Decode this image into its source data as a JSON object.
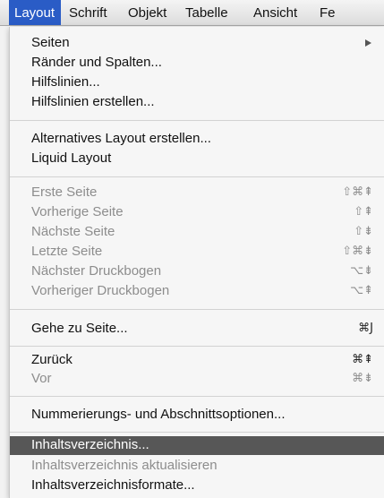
{
  "menubar": {
    "items": [
      "Layout",
      "Schrift",
      "Objekt",
      "Tabelle",
      "Ansicht",
      "Fe"
    ]
  },
  "menu": {
    "seiten": "Seiten",
    "raender": "Ränder und Spalten...",
    "hilfslinien": "Hilfslinien...",
    "hilfslinien_erstellen": "Hilfslinien erstellen...",
    "alt_layout": "Alternatives Layout erstellen...",
    "liquid": "Liquid Layout",
    "erste": {
      "label": "Erste Seite",
      "shortcut": "⇧⌘⇞"
    },
    "vorherige": {
      "label": "Vorherige Seite",
      "shortcut": "⇧⇞"
    },
    "naechste": {
      "label": "Nächste Seite",
      "shortcut": "⇧⇟"
    },
    "letzte": {
      "label": "Letzte Seite",
      "shortcut": "⇧⌘⇟"
    },
    "naechster_db": {
      "label": "Nächster Druckbogen",
      "shortcut": "⌥⇟"
    },
    "vorheriger_db": {
      "label": "Vorheriger Druckbogen",
      "shortcut": "⌥⇞"
    },
    "gehe_zu": {
      "label": "Gehe zu Seite...",
      "shortcut": "⌘J"
    },
    "zurueck": {
      "label": "Zurück",
      "shortcut": "⌘⇞"
    },
    "vor": {
      "label": "Vor",
      "shortcut": "⌘⇟"
    },
    "nummerierung": "Nummerierungs- und Abschnittsoptionen...",
    "iv": "Inhaltsverzeichnis...",
    "iv_aktualisieren": "Inhaltsverzeichnis aktualisieren",
    "iv_formate": "Inhaltsverzeichnisformate..."
  }
}
